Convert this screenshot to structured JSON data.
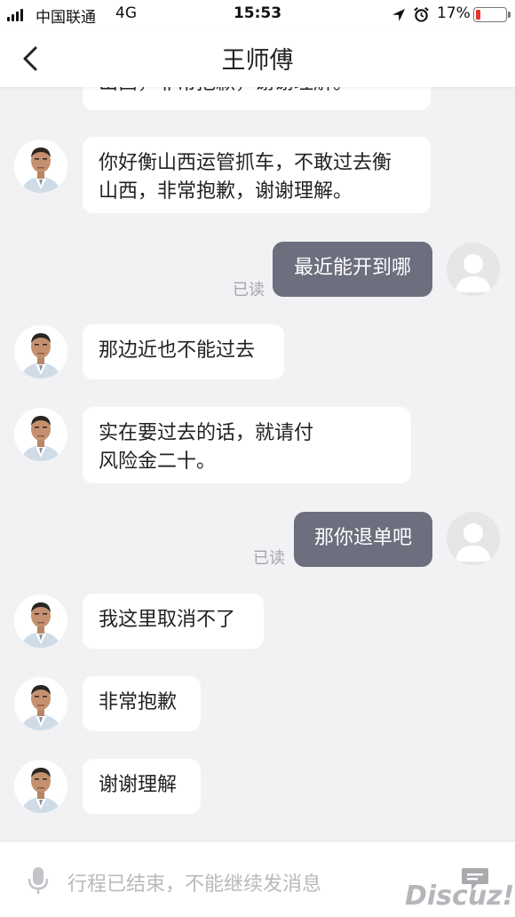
{
  "status_bar": {
    "carrier": "中国联通",
    "network": "4G",
    "time": "15:53",
    "battery_percent": "17%",
    "battery_level": 0.17,
    "icons": [
      "signal-icon",
      "location-icon",
      "alarm-icon",
      "battery-icon"
    ]
  },
  "nav": {
    "title": "王师傅",
    "back_icon": "chevron-left-icon"
  },
  "messages": {
    "m0": "出西，非常抱歉，谢谢理解。",
    "m1_line1": "你好衡山西运管抓车，不敢过去衡",
    "m1_line2": "山西，非常抱歉，谢谢理解。",
    "m2": "最近能开到哪",
    "m2_read": "已读",
    "m3": "那边近也不能过去",
    "m4_line1": "实在要过去的话，就请付",
    "m4_line2": "风险金二十。",
    "m5": "那你退单吧",
    "m5_read": "已读",
    "m6": "我这里取消不了",
    "m7": "非常抱歉",
    "m8": "谢谢理解"
  },
  "bottom_bar": {
    "notice": "行程已结束，不能继续发消息",
    "watermark": "Discuz!",
    "icons": [
      "microphone-icon",
      "message-icon"
    ]
  },
  "colors": {
    "background": "#f2f2f4",
    "outgoing_bubble": "#6d6e7e",
    "incoming_bubble": "#ffffff",
    "battery_low": "#e8352e"
  }
}
